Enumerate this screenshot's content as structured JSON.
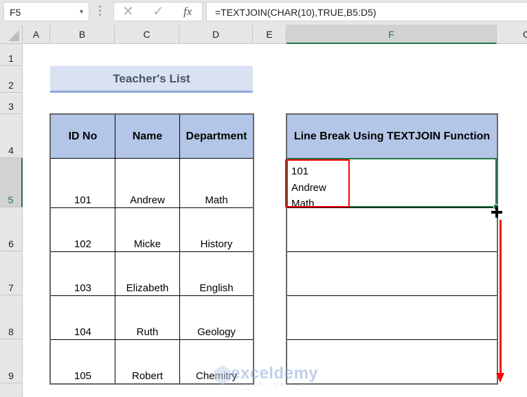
{
  "formula_bar": {
    "name_box": "F5",
    "cancel_icon": "✕",
    "enter_icon": "✓",
    "fx_label": "fx",
    "formula": "=TEXTJOIN(CHAR(10),TRUE,B5:D5)"
  },
  "columns": [
    "A",
    "B",
    "C",
    "D",
    "E",
    "F",
    "G"
  ],
  "selected_column": "F",
  "rows": [
    "1",
    "2",
    "3",
    "4",
    "5",
    "6",
    "7",
    "8",
    "9"
  ],
  "selected_row": "5",
  "sheet": {
    "title": "Teacher's List",
    "table": {
      "headers": [
        "ID No",
        "Name",
        "Department"
      ],
      "rows": [
        [
          "101",
          "Andrew",
          "Math"
        ],
        [
          "102",
          "Micke",
          "History"
        ],
        [
          "103",
          "Elizabeth",
          "English"
        ],
        [
          "104",
          "Ruth",
          "Geology"
        ],
        [
          "105",
          "Robert",
          "Chemitry"
        ]
      ]
    },
    "result_header": "Line Break Using TEXTJOIN Function",
    "result_value_lines": [
      "101",
      "Andrew",
      "Math"
    ]
  },
  "colors": {
    "accent_green": "#217346",
    "header_fill": "#b4c6e7",
    "title_fill": "#d9e1f2",
    "highlight_red": "#ff0000"
  },
  "watermark": {
    "brand": "exceldemy",
    "tagline": "EXCEL · DATA · BI"
  }
}
